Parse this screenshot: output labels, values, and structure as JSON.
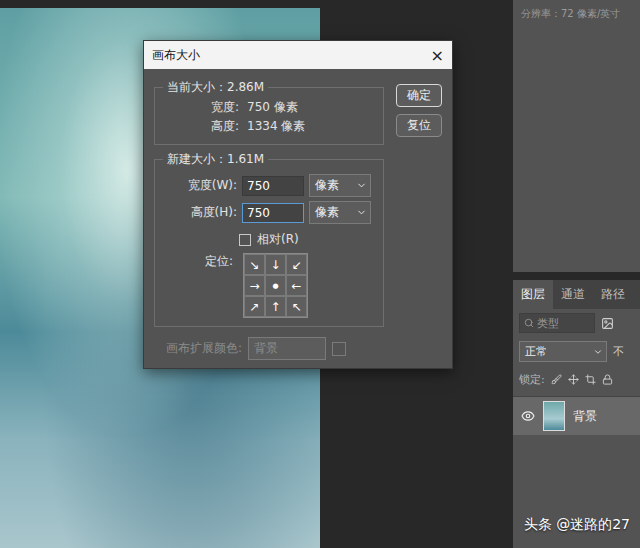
{
  "canvas_info": {
    "resolution": "分辨率：72 像素/英寸"
  },
  "dialog": {
    "title": "画布大小",
    "close": "×",
    "current": {
      "label": "当前大小：2.86M",
      "rows": [
        {
          "label": "宽度:",
          "value": "750 像素"
        },
        {
          "label": "高度:",
          "value": "1334 像素"
        }
      ]
    },
    "new": {
      "label": "新建大小：1.61M",
      "fields": [
        {
          "label": "宽度(W):",
          "value": "750",
          "unit": "像素",
          "focused": false
        },
        {
          "label": "高度(H):",
          "value": "750",
          "unit": "像素",
          "focused": true
        }
      ],
      "relative": {
        "label": "相对(R)",
        "checked": false
      },
      "anchor": {
        "label": "定位:",
        "arrows": [
          "↘",
          "↓",
          "↙",
          "→",
          "●",
          "←",
          "↗",
          "↑",
          "↖"
        ]
      }
    },
    "extension_color": {
      "label": "画布扩展颜色:",
      "value": "背景",
      "disabled": true
    },
    "buttons": [
      {
        "label": "确定",
        "default": true
      },
      {
        "label": "复位",
        "default": false
      }
    ]
  },
  "layers_panel": {
    "tabs": [
      {
        "label": "图层",
        "selected": true
      },
      {
        "label": "通道",
        "selected": false
      },
      {
        "label": "路径",
        "selected": false
      }
    ],
    "search": {
      "placeholder": "类型"
    },
    "blend_mode": "正常",
    "opacity_label": "不",
    "lock_label": "锁定:",
    "layers": [
      {
        "name": "背景",
        "visible": true,
        "selected": true
      }
    ]
  },
  "watermark": "头条 @迷路的27"
}
